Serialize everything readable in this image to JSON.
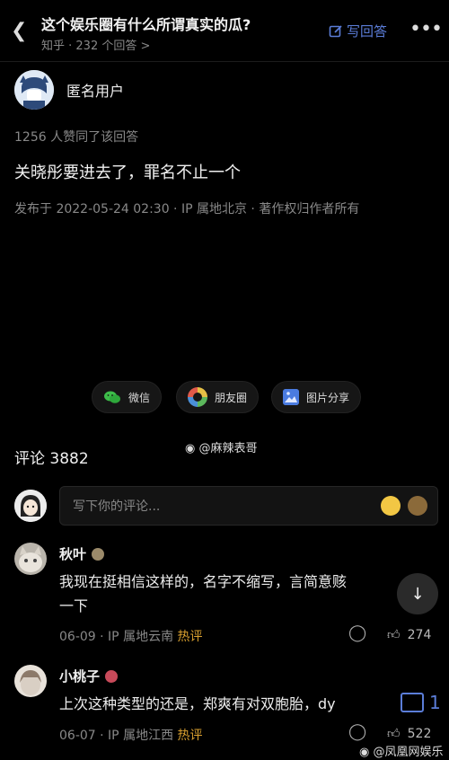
{
  "header": {
    "title": "这个娱乐圈有什么所谓真实的瓜?",
    "subtitle": "知乎 · 232 个回答 >",
    "write_answer": "写回答",
    "more": "•••"
  },
  "answer": {
    "author": "匿名用户",
    "likes": "1256 人赞同了该回答",
    "text": "关晓彤要进去了，罪名不止一个",
    "meta": "发布于 2022-05-24 02:30 · IP 属地北京 · 著作权归作者所有"
  },
  "share": {
    "wechat": "微信",
    "moments": "朋友圈",
    "image_share": "图片分享"
  },
  "watermark_mid": "@麻辣表哥",
  "comments_title": "评论 3882",
  "input": {
    "placeholder": "写下你的评论..."
  },
  "comments": [
    {
      "name": "秋叶",
      "text": "我现在挺相信这样的，名字不缩写，言简意赅…一下",
      "line1": "我现在挺相信这样的，名字不缩写，言简意赅",
      "line2": "一下",
      "date": "06-09",
      "ip": "IP 属地云南",
      "tag": "热评",
      "likes": "274"
    },
    {
      "name": "小桃子",
      "line1": "上次这种类型的还是，郑爽有对双胞胎，dy",
      "date": "06-07",
      "ip": "IP 属地江西",
      "tag": "热评",
      "likes": "522"
    }
  ],
  "float_count": "1",
  "watermark_br": "@凤凰网娱乐",
  "colors": {
    "accent": "#5b7dd8",
    "hot": "#d9a02f",
    "background": "#000000"
  }
}
